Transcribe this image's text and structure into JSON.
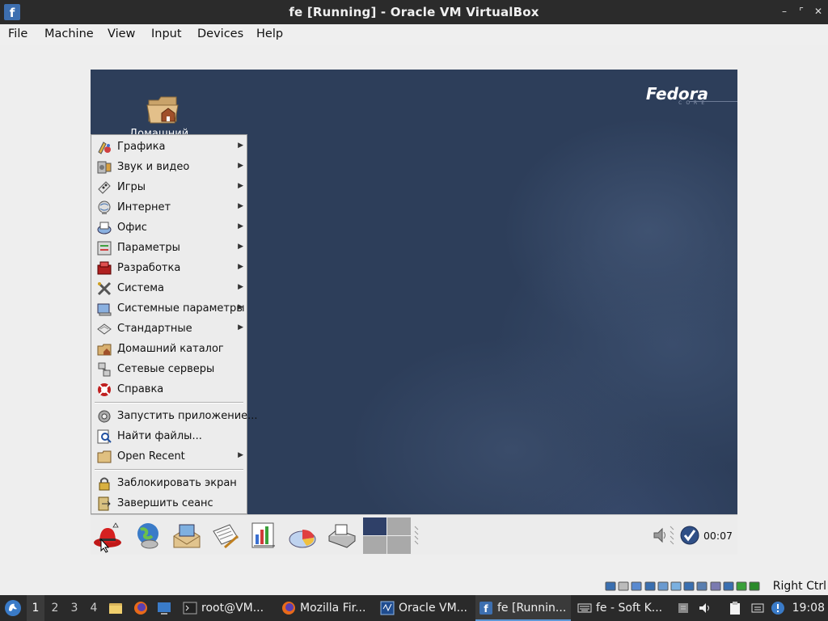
{
  "window": {
    "title": "fe [Running] - Oracle VM VirtualBox",
    "minimize_glyph": "–",
    "restore_glyph": "⌜",
    "close_glyph": "✕"
  },
  "menubar": [
    "File",
    "Machine",
    "View",
    "Input",
    "Devices",
    "Help"
  ],
  "guest": {
    "logo": "Fedora",
    "logo_sub": "CORE",
    "desktop_icon_label": "Домашний",
    "start_menu": {
      "items": [
        {
          "label": "Графика",
          "icon": "graphics-icon",
          "submenu": true
        },
        {
          "label": "Звук и видео",
          "icon": "sound-video-icon",
          "submenu": true
        },
        {
          "label": "Игры",
          "icon": "games-icon",
          "submenu": true
        },
        {
          "label": "Интернет",
          "icon": "internet-icon",
          "submenu": true
        },
        {
          "label": "Офис",
          "icon": "office-icon",
          "submenu": true
        },
        {
          "label": "Параметры",
          "icon": "preferences-icon",
          "submenu": true
        },
        {
          "label": "Разработка",
          "icon": "development-icon",
          "submenu": true
        },
        {
          "label": "Система",
          "icon": "system-tools-icon",
          "submenu": true
        },
        {
          "label": "Системные параметры",
          "icon": "system-settings-icon",
          "submenu": true
        },
        {
          "label": "Стандартные",
          "icon": "accessories-icon",
          "submenu": true
        },
        {
          "label": "Домашний каталог",
          "icon": "home-folder-icon",
          "submenu": false
        },
        {
          "label": "Сетевые серверы",
          "icon": "network-servers-icon",
          "submenu": false
        },
        {
          "label": "Справка",
          "icon": "help-icon",
          "submenu": false
        }
      ],
      "items2": [
        {
          "label": "Запустить приложение...",
          "icon": "run-application-icon",
          "submenu": false
        },
        {
          "label": "Найти файлы...",
          "icon": "search-files-icon",
          "submenu": false
        },
        {
          "label": "Open Recent",
          "icon": "recent-folder-icon",
          "submenu": true
        }
      ],
      "items3": [
        {
          "label": "Заблокировать экран",
          "icon": "lock-icon",
          "submenu": false
        },
        {
          "label": "Завершить сеанс",
          "icon": "logout-icon",
          "submenu": false
        }
      ]
    },
    "panel_clock": "00:07"
  },
  "host_status": {
    "right_ctrl": "Right Ctrl"
  },
  "taskbar": {
    "workspaces": [
      "1",
      "2",
      "3",
      "4"
    ],
    "tasks": [
      {
        "label": "root@VM...",
        "icon": "terminal-icon"
      },
      {
        "label": "Mozilla Fir...",
        "icon": "firefox-icon"
      },
      {
        "label": "Oracle VM...",
        "icon": "virtualbox-icon"
      },
      {
        "label": "fe [Runnin...",
        "icon": "virtualbox-vm-icon"
      },
      {
        "label": "fe - Soft K...",
        "icon": "keyboard-icon"
      }
    ],
    "clock": "19:08"
  },
  "colors": {
    "desktop": "#2d3e5a",
    "taskbar": "#2a2a2a",
    "menu_bg": "#ececec",
    "accent": "#5d97d6"
  }
}
